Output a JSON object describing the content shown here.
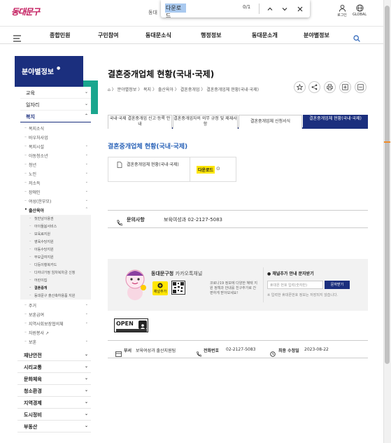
{
  "header": {
    "logo_text": "동대문구",
    "util_text": "동대",
    "login_label": "로그인",
    "global_label": "GLOBAL"
  },
  "find_bar": {
    "query": "다운로드",
    "count": "0/1"
  },
  "nav": {
    "items": [
      "종합민원",
      "구민참여",
      "동대문소식",
      "행정정보",
      "동대문소개",
      "분야별정보"
    ]
  },
  "sidebar": {
    "title": "분야별정보",
    "categories": [
      {
        "label": "교육",
        "chev": "⌄"
      },
      {
        "label": "일자리",
        "chev": "⌄"
      },
      {
        "label": "복지",
        "chev": "⌃"
      }
    ],
    "sub_items": [
      {
        "label": "복지소식",
        "chev": ""
      },
      {
        "label": "바우처사업",
        "chev": ""
      },
      {
        "label": "복지시설",
        "chev": "⌄"
      },
      {
        "label": "아동청소년",
        "chev": "⌄"
      },
      {
        "label": "청년",
        "chev": "⌄"
      },
      {
        "label": "노인",
        "chev": "⌄"
      },
      {
        "label": "저소득",
        "chev": "⌄"
      },
      {
        "label": "장애인",
        "chev": "⌄"
      },
      {
        "label": "여성(한부모)",
        "chev": "⌄"
      },
      {
        "label": "출산육아",
        "chev": "⌃"
      }
    ],
    "subsub_items": [
      "첫만남이용권",
      "아이돌봄서비스",
      "보육료지원",
      "영육수당지원",
      "아동수당지원",
      "부모급여지원",
      "다둥이행복카드",
      "다자녀가정 임차복차금 신청",
      "어린이집",
      "결혼중개",
      "동대문구 출산축하용품 지원"
    ],
    "after_sub_items": [
      {
        "label": "주거",
        "chev": "⌄"
      },
      {
        "label": "보훈급여",
        "chev": "⌄"
      },
      {
        "label": "지역사회보장협의체",
        "chev": "⌄"
      },
      {
        "label": "자원봉사 ↗",
        "chev": ""
      },
      {
        "label": "보훈",
        "chev": "⌄"
      }
    ],
    "bottom_categories": [
      "재난안전",
      "시리교통",
      "문화체육",
      "청소환경",
      "지역경제",
      "도시정비",
      "부동산"
    ]
  },
  "content": {
    "title": "결혼중개업체 현황(국내·국제)",
    "breadcrumb": "⌂  〉 분야별정보 〉 복지 〉 출산육아 〉 결혼중개업 〉 결혼중개업체 현황(국내·국제)",
    "tabs": [
      "국내·국제 결혼중개업 신고·등록 안내",
      "결혼중개업자의 의무 규정 및 제재사항",
      "결혼중개업체 신청서식",
      "결혼중개업체 현황(국내·국제)"
    ],
    "section_title": "결혼중개업체 현황(국내·국제)",
    "file_name": "결혼중개업체 현황(국내·국제)",
    "download_label": "다운로드",
    "contact_label": "문의사항",
    "contact_value": "보육여성과 02-2127-5083"
  },
  "kakao": {
    "title": "동대문구청",
    "title_suffix": "카카오톡채널",
    "add_label": "채널추가",
    "desc": "코로나19 정보에 다양한 혜택 지원 정책과 안내를 친구추가로 간편하게 받아보세요!",
    "sms_title": "채널추가 안내 문자받기",
    "sms_placeholder": "휴대폰 번호 입력(숫자만)",
    "sms_button": "문자받기",
    "sms_note": "※ 입력한 휴대폰번호 정보는 저장되지 않습니다."
  },
  "footer": {
    "open_label": "OPEN",
    "dept_label": "부서",
    "dept_value": "보육여성과 출산지원팀",
    "phone_label": "전화번호",
    "phone_value": "02-2127-5083",
    "updated_label": "최종 수정일",
    "updated_value": "2023-08-22"
  }
}
